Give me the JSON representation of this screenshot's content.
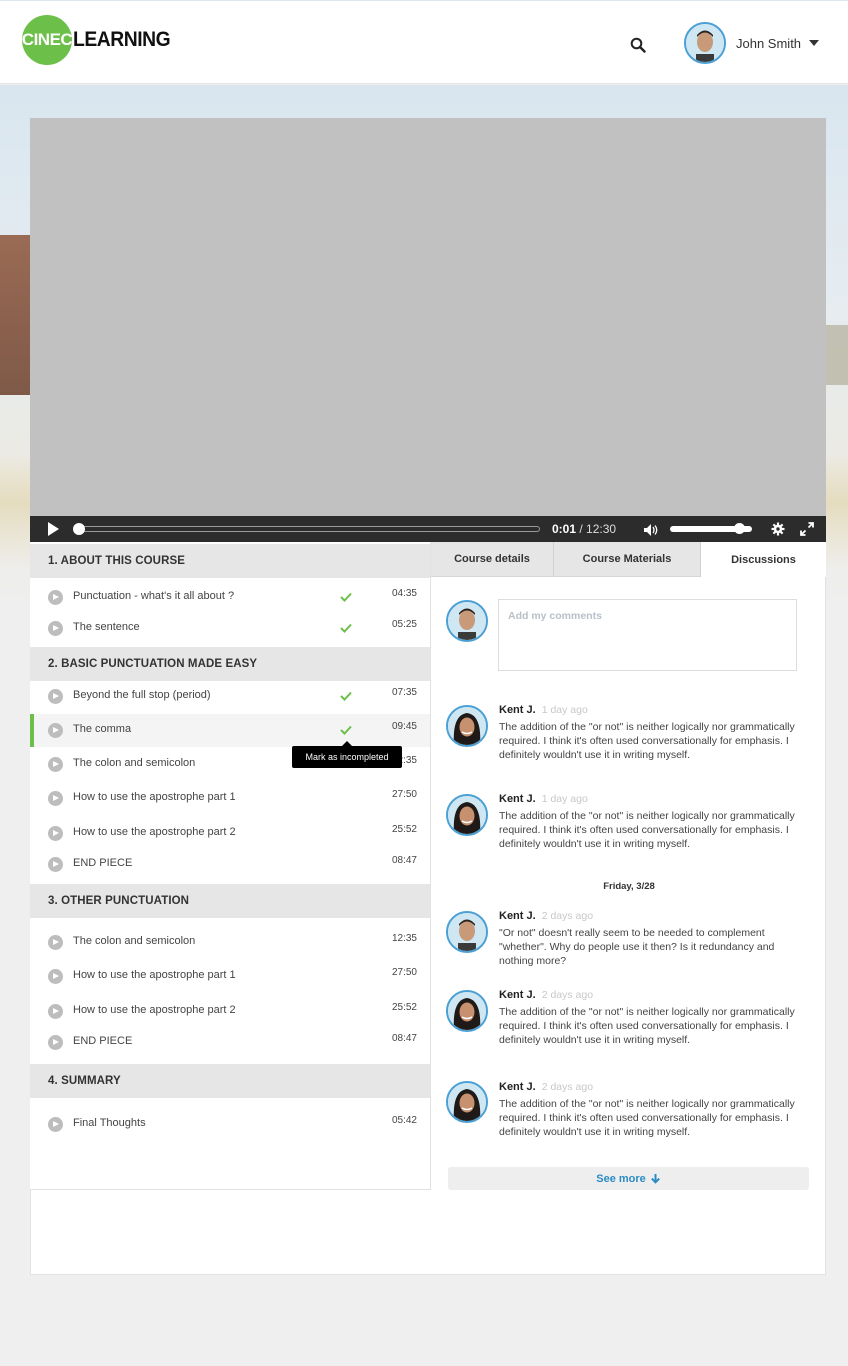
{
  "header": {
    "logo_mark": "CINEC",
    "logo_word": "LEARNING",
    "user_name": "John Smith"
  },
  "player": {
    "current_time": "0:01",
    "separator": " / ",
    "duration": "12:30",
    "progress_fraction": 0.0,
    "volume_fraction": 0.9
  },
  "course": {
    "sections": [
      {
        "title": "1. ABOUT THIS COURSE",
        "lessons": [
          {
            "title": "Punctuation - what's it all about ?",
            "duration": "04:35",
            "completed": true
          },
          {
            "title": "The sentence",
            "duration": "05:25",
            "completed": true
          }
        ]
      },
      {
        "title": "2. BASIC PUNCTUATION MADE EASY",
        "lessons": [
          {
            "title": "Beyond the full stop (period)",
            "duration": "07:35",
            "completed": true
          },
          {
            "title": "The comma",
            "duration": "09:45",
            "completed": true,
            "active": true
          },
          {
            "title": "The colon and semicolon",
            "duration": "12:35",
            "completed": false
          },
          {
            "title": "How to use the apostrophe part 1",
            "duration": "27:50",
            "completed": false
          },
          {
            "title": "How to use the apostrophe part 2",
            "duration": "25:52",
            "completed": false
          },
          {
            "title": "END PIECE",
            "duration": "08:47",
            "completed": false
          }
        ]
      },
      {
        "title": "3. OTHER PUNCTUATION",
        "lessons": [
          {
            "title": "The colon and semicolon",
            "duration": "12:35",
            "completed": false
          },
          {
            "title": "How to use the apostrophe part 1",
            "duration": "27:50",
            "completed": false
          },
          {
            "title": "How to use the apostrophe part 2",
            "duration": "25:52",
            "completed": false
          },
          {
            "title": "END PIECE",
            "duration": "08:47",
            "completed": false
          }
        ]
      },
      {
        "title": "4. SUMMARY",
        "lessons": [
          {
            "title": "Final Thoughts",
            "duration": "05:42",
            "completed": false
          }
        ]
      }
    ],
    "tooltip": "Mark as  incompleted"
  },
  "tabs": [
    {
      "label": "Course details",
      "active": false
    },
    {
      "label": "Course Materials",
      "active": false
    },
    {
      "label": "Discussions",
      "active": true
    }
  ],
  "discussions": {
    "comment_placeholder": "Add my comments",
    "comments": [
      {
        "author": "Kent J.",
        "time": "1 day ago",
        "avatar": "kent",
        "text": "The addition of the \"or not\" is neither logically nor grammatically required. I think it's often used conversationally for emphasis. I definitely wouldn't use it in writing myself."
      },
      {
        "author": "Kent J.",
        "time": "1 day ago",
        "avatar": "kent",
        "text": "The addition of the \"or not\" is neither logically nor grammatically required. I think it's often used conversationally for emphasis. I definitely wouldn't use it in writing myself."
      },
      {
        "author": "Kent J.",
        "time": "2 days ago",
        "avatar": "john",
        "text": "\"Or not\" doesn't really seem to be needed to complement \"whether\". Why do people use it then? Is it redundancy and nothing more?"
      },
      {
        "author": "Kent J.",
        "time": "2 days ago",
        "avatar": "kent",
        "text": "The addition of the \"or not\" is neither logically nor grammatically required. I think it's often used conversationally for emphasis. I definitely wouldn't use it in writing myself."
      },
      {
        "author": "Kent J.",
        "time": "2 days ago",
        "avatar": "kent",
        "text": "The addition of the \"or not\" is neither logically nor grammatically required. I think it's often used conversationally for emphasis. I definitely wouldn't use it in writing myself."
      }
    ],
    "date_separator": "Friday, 3/28",
    "see_more": "See more"
  },
  "colors": {
    "brand_green": "#6cc04a",
    "link_blue": "#2b8cc4",
    "check_green": "#6cc04a"
  },
  "icons": [
    "search-icon",
    "chevron-down-icon",
    "play-icon",
    "volume-icon",
    "gear-icon",
    "fullscreen-icon",
    "check-icon",
    "arrow-down-icon"
  ]
}
